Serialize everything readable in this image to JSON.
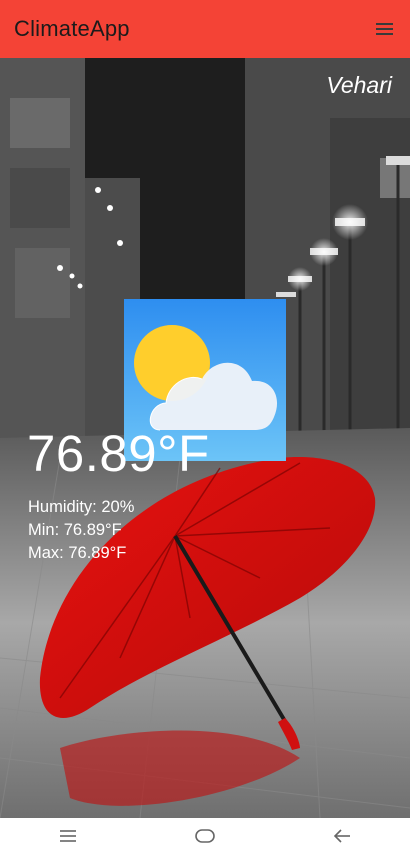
{
  "app_bar": {
    "title": "ClimateApp",
    "menu_icon": "hamburger-menu-icon",
    "background_color": "#f44336"
  },
  "weather": {
    "city": "Vehari",
    "icon": "partly-cloudy-icon",
    "temperature": "76.89°F",
    "humidity": "Humidity: 20%",
    "min": "Min: 76.89°F",
    "max": "Max: 76.89°F"
  },
  "system_nav": {
    "recents_icon": "recents-icon",
    "home_icon": "home-icon",
    "back_icon": "back-icon"
  }
}
